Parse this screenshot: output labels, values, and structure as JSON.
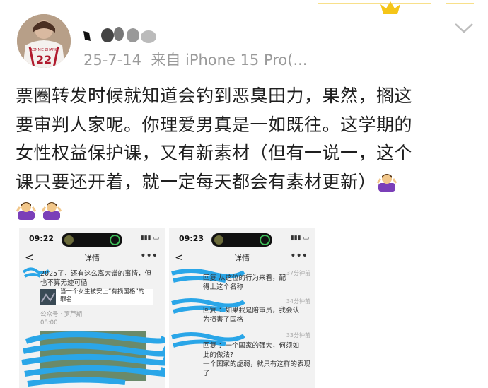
{
  "post": {
    "username": "",
    "date": "25-7-14",
    "source": "来自 iPhone 15 Pro(...",
    "line1": "票圈转发时候就知道会钓到恶臭田力，果然，搁这",
    "line2": "要审判人家呢。你理爱男真是一如既往。这学期的",
    "line3": "女性权益保护课，又有新素材（但有一说一，这个",
    "line4": "课只要还开着，就一定每天都会有素材更新）",
    "avatar_jersey": "22",
    "avatar_text": "RONNIE ZHANG"
  },
  "icons": {
    "emoji": "woman-shrugging",
    "chevron": "chevron-down-icon",
    "crown": "crown-icon"
  },
  "colors": {
    "meta_gray": "#9a9a9a",
    "scribble_blue": "#2aa6e8",
    "emoji_purple": "#7b3fb8",
    "crown_gold": "#f5c518"
  },
  "screenshot1": {
    "time": "09:22",
    "nav_title": "详情",
    "back": "<",
    "more": "•••",
    "text1": "2025了，还有这么离大谱的事情，但",
    "text2": "也不算无迹可循",
    "card_line1": "当一个女生被安上“有损国格”的",
    "card_line2": "罪名",
    "source": "公众号 · 罗芦期",
    "time2": "08:00"
  },
  "screenshot2": {
    "time": "09:23",
    "nav_title": "详情",
    "back": "<",
    "more": "•••",
    "c1_time": "37分钟前",
    "c1_l1": "回复      从这位的行为来看，配",
    "c1_l2": "得上这个名称",
    "c2_time": "34分钟前",
    "c2_l1": "回复      ：如果我是陪审员，我会认",
    "c2_l2": "为损害了国格",
    "c3_time": "33分钟前",
    "c3_l1": "回复      ：一个国家的强大，何须如",
    "c3_l2": "此的做法?",
    "c3_l3": "一个国家的虚弱，就只有这样的表现",
    "c3_l4": "了"
  }
}
